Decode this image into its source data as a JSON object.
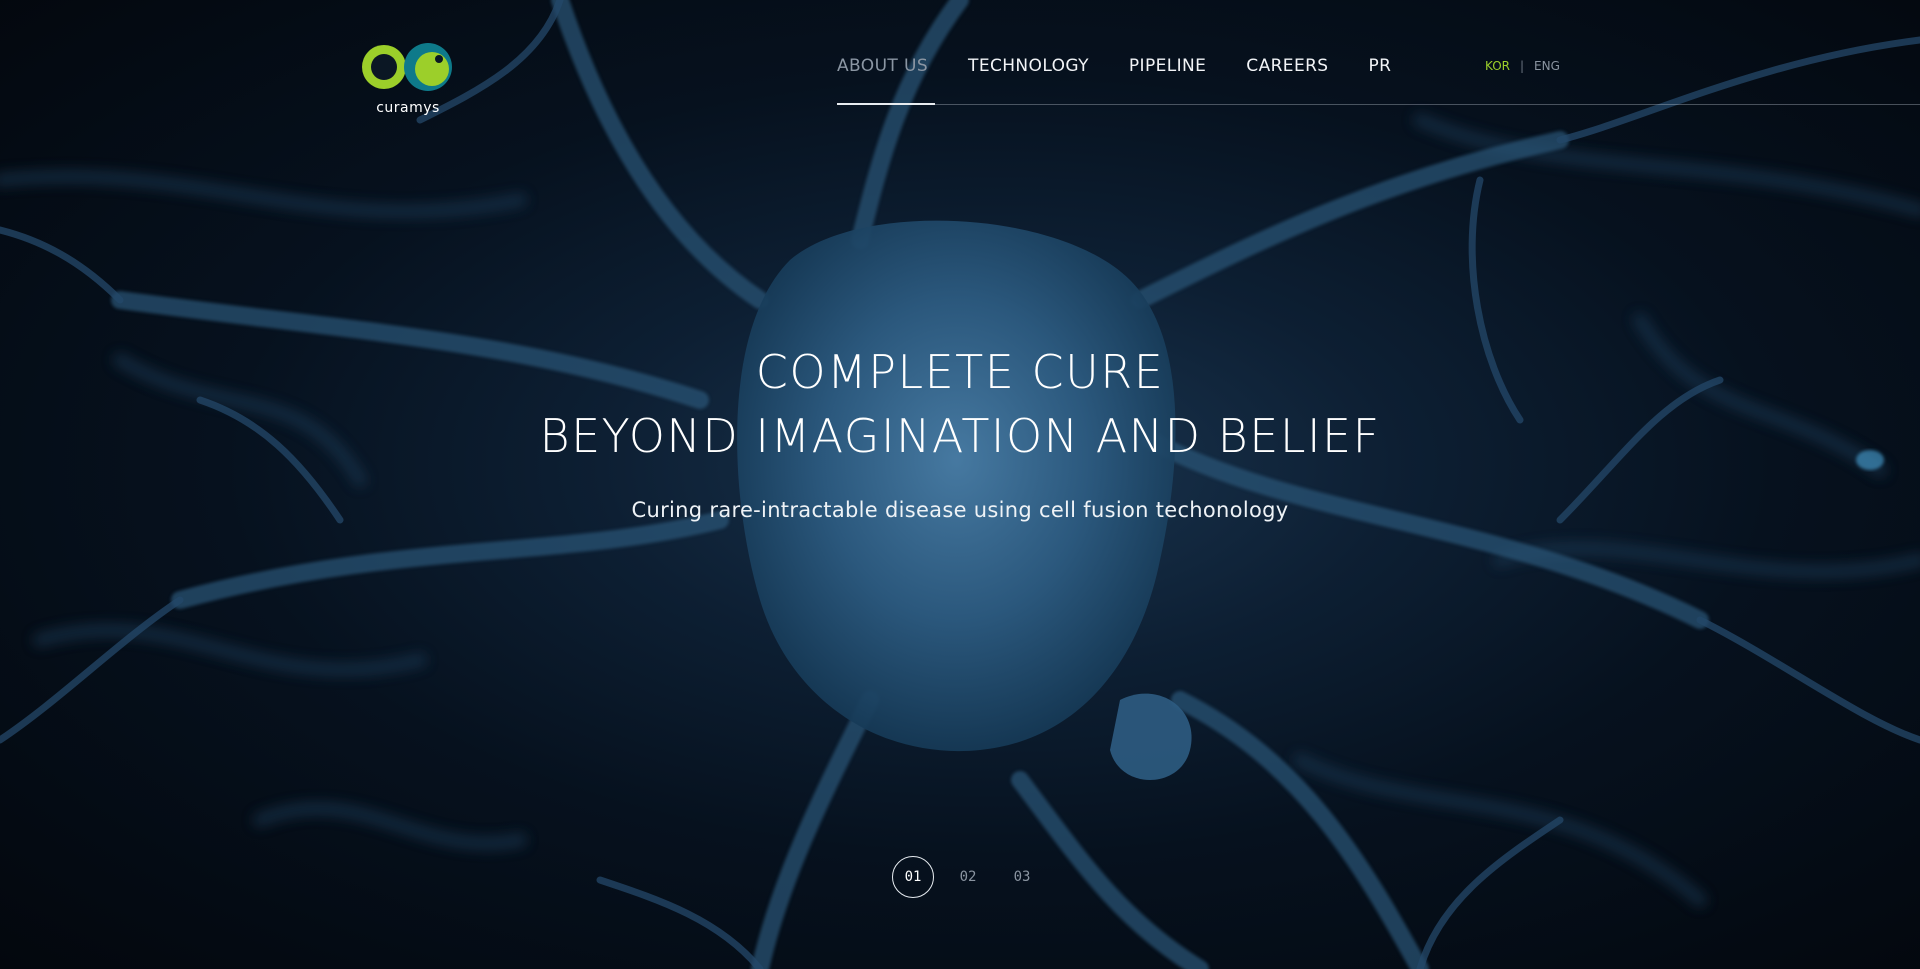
{
  "brand": {
    "name": "curamys",
    "colors": {
      "lime": "#9ccf2a",
      "teal": "#0e7a8a"
    }
  },
  "nav": {
    "items": [
      {
        "label": "ABOUT US",
        "active": true
      },
      {
        "label": "TECHNOLOGY",
        "active": false
      },
      {
        "label": "PIPELINE",
        "active": false
      },
      {
        "label": "CAREERS",
        "active": false
      },
      {
        "label": "PR",
        "active": false
      }
    ]
  },
  "lang": {
    "kor": "KOR",
    "separator": "|",
    "eng": "ENG",
    "active": "KOR"
  },
  "hero": {
    "line1": "COMPLETE CURE",
    "line2": "BEYOND IMAGINATION AND BELIEF",
    "subtitle": "Curing rare-intractable disease using cell fusion techonology",
    "background": "neuron-illustration"
  },
  "pager": {
    "pages": [
      "01",
      "02",
      "03"
    ],
    "current": "01"
  }
}
